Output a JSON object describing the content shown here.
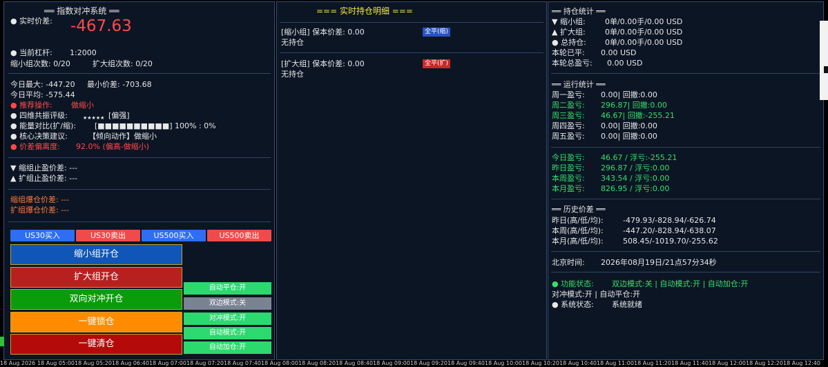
{
  "left": {
    "title": "══ 指数对冲系统 ══",
    "price_label": "● 实时价差:",
    "price_value": "-467.63",
    "leverage_label": "● 当前杠杆:",
    "leverage_value": "1:2000",
    "shrink_count": "缩小组次数: 0/20",
    "expand_count": "扩大组次数: 0/20",
    "today_max": "今日最大: -447.20",
    "min_price": "最小价差: -703.68",
    "today_avg": "今日平均: -575.44",
    "recommend_label": "● 推荐操作:",
    "recommend_value": "做缩小",
    "resonance_label": "● 四维共振评级:",
    "resonance_stars": "★★★★★",
    "resonance_value": "[偏强]",
    "energy_label": "● 能量对比(扩/缩):",
    "energy_value": "[■■■■■■■■■■] 100% : 0%",
    "decision_label": "● 核心决策建议:",
    "decision_value": "【倾向动作】做缩小",
    "deviation_label": "● 价差偏离度:",
    "deviation_value": "92.0% (偏高-做缩小)",
    "shrink_tp": "▼ 缩组止盈价差: ---",
    "expand_tp": "▲ 扩组止盈价差: ---",
    "shrink_liq": "缩组爆仓价差: ---",
    "expand_liq": "扩组爆仓价差: ---",
    "buttons": {
      "us30_buy": "US30买入",
      "us30_sell": "US30卖出",
      "us500_buy": "US500买入",
      "us500_sell": "US500卖出",
      "open_shrink": "缩小组开仓",
      "open_expand": "扩大组开仓",
      "open_hedge": "双向对冲开仓",
      "lock": "一键锁仓",
      "clear": "一键清仓"
    },
    "toggles": {
      "auto_close": "自动平仓:开",
      "dual_mode": "双边模式:关",
      "hedge_mode": "对冲模式:开",
      "auto_mode": "自动模式:开",
      "auto_add": "自动加仓:开"
    }
  },
  "middle": {
    "title": "=== 实时持仓明细 ===",
    "shrink_header": "[缩小组] 保本价差: 0.00",
    "shrink_close": "全平(缩)",
    "shrink_status": "无持仓",
    "expand_header": "[扩大组] 保本价差: 0.00",
    "expand_close": "全平(扩)",
    "expand_status": "无持仓"
  },
  "right": {
    "position_title": "══ 持仓统计 ══",
    "shrink_stat_label": "▼ 缩小组:",
    "shrink_stat_value": "0单/0.00手/0.00 USD",
    "expand_stat_label": "▲ 扩大组:",
    "expand_stat_value": "0单/0.00手/0.00 USD",
    "total_stat_label": "● 总持仓:",
    "total_stat_value": "0单/0.00手/0.00 USD",
    "round_closed_label": "本轮已平:",
    "round_closed_value": "0.00 USD",
    "round_total_label": "本轮总盈亏:",
    "round_total_value": "0.00 USD",
    "run_title": "══ 运行统计 ══",
    "weekdays": [
      {
        "label": "周一盈亏:",
        "value": "0.00| 回撤:0.00"
      },
      {
        "label": "周二盈亏:",
        "value": "296.87| 回撤:0.00"
      },
      {
        "label": "周三盈亏:",
        "value": "46.67| 回撤:-255.21"
      },
      {
        "label": "周四盈亏:",
        "value": "0.00| 回撤:0.00"
      },
      {
        "label": "周五盈亏:",
        "value": "0.00| 回撤:0.00"
      }
    ],
    "periods": [
      {
        "label": "今日盈亏:",
        "value": "46.67 / 浮亏:-255.21"
      },
      {
        "label": "昨日盈亏:",
        "value": "296.87 / 浮亏:0.00"
      },
      {
        "label": "本周盈亏:",
        "value": "343.54 / 浮亏:0.00"
      },
      {
        "label": "本月盈亏:",
        "value": "826.95 / 浮亏:0.00"
      }
    ],
    "history_title": "══ 历史价差 ══",
    "history": [
      {
        "label": "昨日(高/低/均):",
        "value": "-479.93/-828.94/-626.74"
      },
      {
        "label": "本周(高/低/均):",
        "value": "-447.20/-828.94/-638.07"
      },
      {
        "label": "本月(高/低/均):",
        "value": "508.45/-1019.70/-255.62"
      }
    ],
    "beijing_label": "北京时间:",
    "beijing_value": "2026年08月19日/21点57分34秒",
    "func_label": "● 功能状态:",
    "func_value": "双边模式:关 | 自动模式:开 | 自动加仓:开",
    "func_line2": "对冲模式:开 | 自动平仓:开",
    "sys_label": "● 系统状态:",
    "sys_value": "系统就绪"
  },
  "axis_ticks": [
    "18 Aug 2026",
    "18 Aug 05:00",
    "18 Aug 05:20",
    "18 Aug 06:40",
    "18 Aug 07:00",
    "18 Aug 07:20",
    "18 Aug 07:40",
    "18 Aug 08:00",
    "18 Aug 08:20",
    "18 Aug 08:40",
    "18 Aug 09:00",
    "18 Aug 09:20",
    "18 Aug 09:40",
    "18 Aug 10:00",
    "18 Aug 10:20",
    "18 Aug 10:40",
    "18 Aug 11:00",
    "18 Aug 11:20",
    "18 Aug 11:40",
    "18 Aug 12:00",
    "18 Aug 12:20",
    "18 Aug 12:40"
  ],
  "colors": {
    "panel_bg": "#0c1524",
    "border": "#35507a",
    "red": "#ff4a4a",
    "green": "#35e06a",
    "yellow": "#f2ea3a",
    "blue_btn": "#2d6ef2"
  }
}
